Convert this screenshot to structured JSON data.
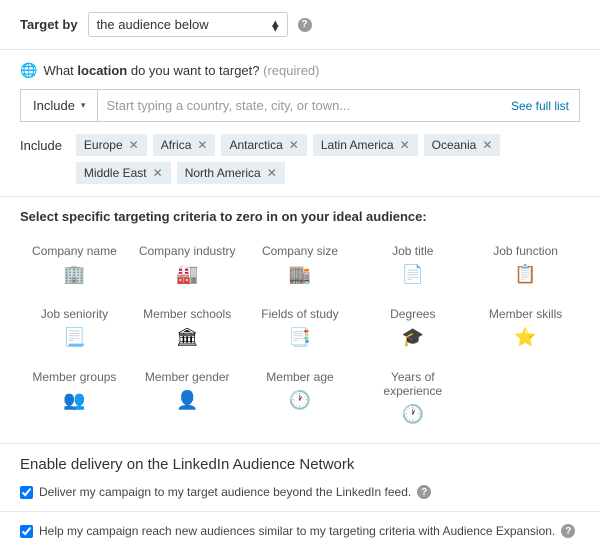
{
  "targetBy": {
    "label": "Target by",
    "selectValue": "the audience below"
  },
  "location": {
    "questionPrefix": "What ",
    "questionEmph": "location",
    "questionSuffix": " do you want to target? ",
    "requiredText": "(required)",
    "includeLabel": "Include",
    "inputPlaceholder": "Start typing a country, state, city, or town...",
    "seeFull": "See full list",
    "tagsLabel": "Include",
    "tags": [
      "Europe",
      "Africa",
      "Antarctica",
      "Latin America",
      "Oceania",
      "Middle East",
      "North America"
    ]
  },
  "criteria": {
    "heading": "Select specific targeting criteria to zero in on your ideal audience:",
    "items": [
      {
        "label": "Company name",
        "icon": "🏢"
      },
      {
        "label": "Company industry",
        "icon": "🏭"
      },
      {
        "label": "Company size",
        "icon": "🏬"
      },
      {
        "label": "Job title",
        "icon": "📄"
      },
      {
        "label": "Job function",
        "icon": "📋"
      },
      {
        "label": "Job seniority",
        "icon": "📃"
      },
      {
        "label": "Member schools",
        "icon": "🏛"
      },
      {
        "label": "Fields of study",
        "icon": "📑"
      },
      {
        "label": "Degrees",
        "icon": "🎓"
      },
      {
        "label": "Member skills",
        "icon": "⭐"
      },
      {
        "label": "Member groups",
        "icon": "👥"
      },
      {
        "label": "Member gender",
        "icon": "👤"
      },
      {
        "label": "Member age",
        "icon": "🕐"
      },
      {
        "label": "Years of experience",
        "icon": "🕐"
      }
    ]
  },
  "delivery": {
    "heading": "Enable delivery on the LinkedIn Audience Network",
    "check1": "Deliver my campaign to my target audience beyond the LinkedIn feed.",
    "check2": "Help my campaign reach new audiences similar to my targeting criteria with Audience Expansion."
  }
}
